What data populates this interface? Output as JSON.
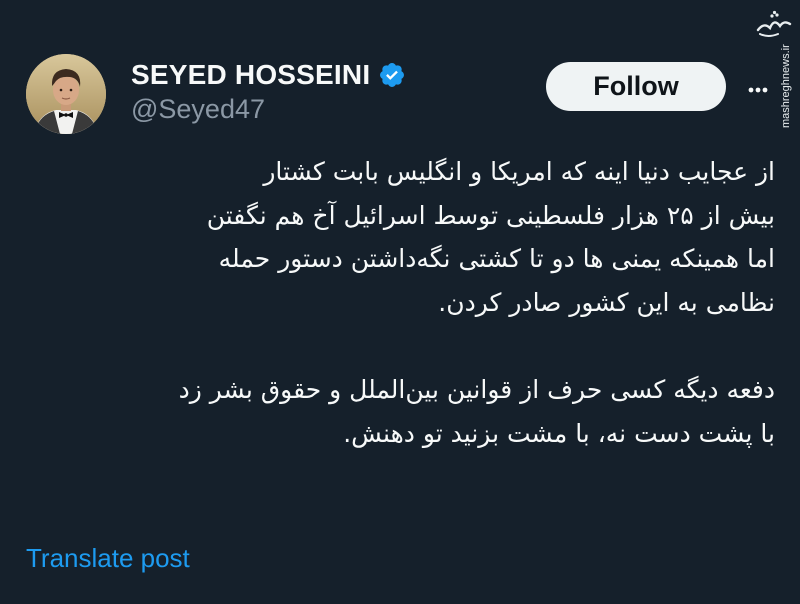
{
  "author": {
    "display_name": "SEYED HOSSEINI",
    "handle": "@Seyed47",
    "verified": true
  },
  "actions": {
    "follow_label": "Follow",
    "more_icon": "more-horizontal-icon"
  },
  "tweet": {
    "paragraphs": [
      [
        "از عجایب دنیا اینه که امریکا و انگلیس بابت کشتار",
        "بیش از ۲۵ هزار فلسطینی توسط اسرائیل آخ هم نگفتن",
        "اما همینکه یمنی ها دو تا کشتی نگه‌داشتن دستور حمله",
        "نظامی به این کشور صادر کردن."
      ],
      [
        "دفعه دیگه کسی حرف از قوانین بین‌الملل و حقوق بشر زد",
        "با پشت دست نه، با مشت بزنید تو دهنش."
      ]
    ],
    "translate_label": "Translate post"
  },
  "watermark": {
    "logo_text": "مشرق",
    "url": "mashreghnews.ir"
  },
  "colors": {
    "background": "#15202b",
    "text_primary": "#f7f9f9",
    "text_secondary": "#8b98a5",
    "accent_blue": "#1d9bf0",
    "follow_button_bg": "#eff3f4"
  }
}
